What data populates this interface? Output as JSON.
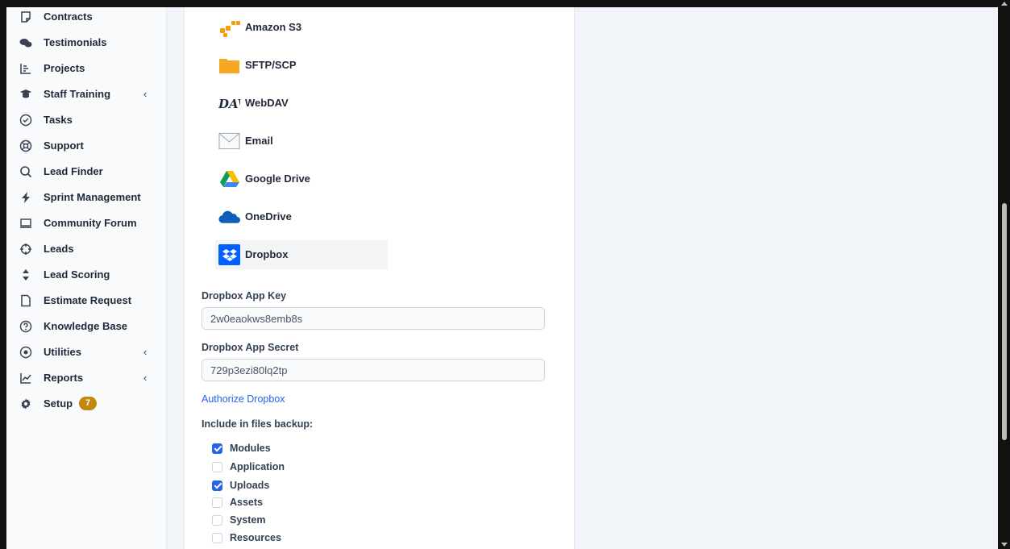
{
  "sidebar": {
    "items": [
      {
        "label": "Contracts",
        "icon": "document-icon"
      },
      {
        "label": "Testimonials",
        "icon": "chat-bubbles-icon"
      },
      {
        "label": "Projects",
        "icon": "chart-bars-icon"
      },
      {
        "label": "Staff Training",
        "icon": "graduation-cap-icon",
        "chevron": "‹"
      },
      {
        "label": "Tasks",
        "icon": "check-circle-icon"
      },
      {
        "label": "Support",
        "icon": "lifebuoy-icon"
      },
      {
        "label": "Lead Finder",
        "icon": "search-icon"
      },
      {
        "label": "Sprint Management",
        "icon": "lightning-icon"
      },
      {
        "label": "Community Forum",
        "icon": "laptop-icon"
      },
      {
        "label": "Leads",
        "icon": "crosshair-icon"
      },
      {
        "label": "Lead Scoring",
        "icon": "sort-icon"
      },
      {
        "label": "Estimate Request",
        "icon": "file-icon"
      },
      {
        "label": "Knowledge Base",
        "icon": "question-circle-icon"
      },
      {
        "label": "Utilities",
        "icon": "dot-circle-icon",
        "chevron": "‹"
      },
      {
        "label": "Reports",
        "icon": "line-chart-icon",
        "chevron": "‹"
      },
      {
        "label": "Setup",
        "icon": "gear-icon",
        "badge": "7"
      }
    ]
  },
  "storage": {
    "options": [
      {
        "label": "Amazon S3",
        "icon": "amazon-s3-icon",
        "color": "#f59e0b"
      },
      {
        "label": "SFTP/SCP",
        "icon": "folder-icon",
        "color": "#f6a823"
      },
      {
        "label": "WebDAV",
        "icon": "webdav-icon",
        "color": "#1e293b"
      },
      {
        "label": "Email",
        "icon": "envelope-icon",
        "color": "#9ca3af"
      },
      {
        "label": "Google Drive",
        "icon": "google-drive-icon",
        "color": "#0f9d58"
      },
      {
        "label": "OneDrive",
        "icon": "onedrive-icon",
        "color": "#0f5fb8"
      },
      {
        "label": "Dropbox",
        "icon": "dropbox-icon",
        "color": "#0061fe",
        "active": true
      }
    ]
  },
  "form": {
    "app_key_label": "Dropbox App Key",
    "app_key_value": "2w0eaokws8emb8s",
    "app_secret_label": "Dropbox App Secret",
    "app_secret_value": "729p3ezi80lq2tp",
    "authorize_link": "Authorize Dropbox",
    "backup_label": "Include in files backup:",
    "backup_options": [
      {
        "label": "Modules",
        "checked": true
      },
      {
        "label": "Application",
        "checked": false
      },
      {
        "label": "Uploads",
        "checked": true
      },
      {
        "label": "Assets",
        "checked": false
      },
      {
        "label": "System",
        "checked": false
      },
      {
        "label": "Resources",
        "checked": false
      }
    ]
  },
  "colors": {
    "accent": "#2563eb",
    "badge": "#c2870e"
  }
}
